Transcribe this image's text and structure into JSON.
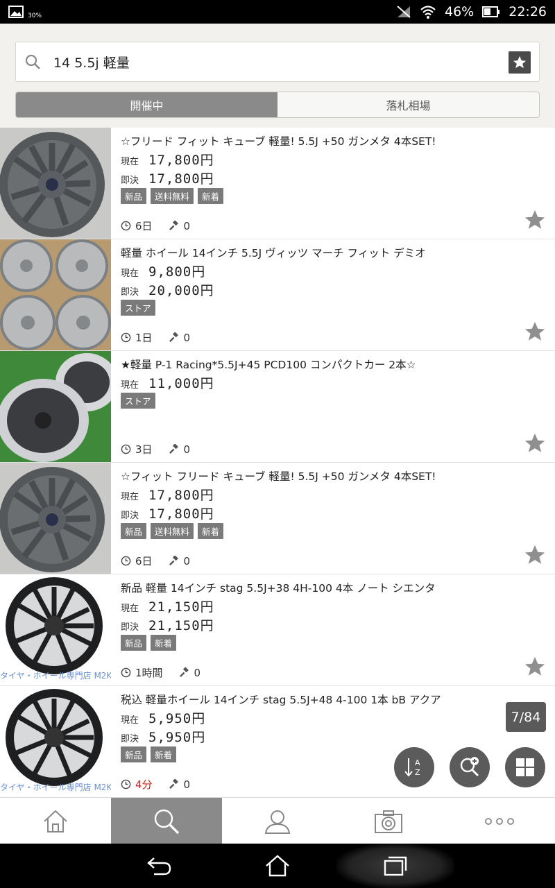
{
  "status_bar": {
    "battery_small": "30%",
    "battery_pct": "46%",
    "time": "22:26"
  },
  "search": {
    "query": "14 5.5j 軽量"
  },
  "tabs": [
    {
      "label": "開催中",
      "active": true
    },
    {
      "label": "落札相場",
      "active": false
    }
  ],
  "price_labels": {
    "current": "現在",
    "buyout": "即決"
  },
  "items": [
    {
      "title": "☆フリード フィット キューブ 軽量! 5.5J +50 ガンメタ 4本SET!",
      "current": "17,800円",
      "buyout": "17,800円",
      "badges": [
        "新品",
        "送料無料",
        "新着"
      ],
      "time_left": "6日",
      "bids": "0",
      "thumb": "gunmetal-wheel"
    },
    {
      "title": "軽量 ホイール 14インチ 5.5J ヴィッツ マーチ フィット デミオ",
      "current": "9,800円",
      "buyout": "20,000円",
      "badges": [
        "ストア"
      ],
      "time_left": "1日",
      "bids": "0",
      "thumb": "silver-wheels-4"
    },
    {
      "title": "★軽量 P-1 Racing*5.5J+45 PCD100 コンパクトカー 2本☆",
      "current": "11,000円",
      "buyout": null,
      "badges": [
        "ストア"
      ],
      "time_left": "3日",
      "bids": "0",
      "thumb": "wheels-on-grass"
    },
    {
      "title": "☆フィット フリード キューブ 軽量! 5.5J +50 ガンメタ 4本SET!",
      "current": "17,800円",
      "buyout": "17,800円",
      "badges": [
        "新品",
        "送料無料",
        "新着"
      ],
      "time_left": "6日",
      "bids": "0",
      "thumb": "gunmetal-wheel"
    },
    {
      "title": "新品 軽量 14インチ stag 5.5J+38 4H-100 4本 ノート シエンタ",
      "current": "21,150円",
      "buyout": "21,150円",
      "badges": [
        "新品",
        "新着"
      ],
      "time_left": "1時間",
      "bids": "0",
      "thumb": "black-polished-wheel",
      "watermark": "タイヤ・ホイール専門店 M2K"
    },
    {
      "title": "税込 軽量ホイール 14インチ stag 5.5J+48 4-100 1本 bB アクア",
      "current": "5,950円",
      "buyout": "5,950円",
      "badges": [
        "新品",
        "新着"
      ],
      "time_left": "4分",
      "time_urgent": true,
      "bids": "0",
      "thumb": "black-polished-wheel",
      "watermark": "タイヤ・ホイール専門店 M2K"
    }
  ],
  "page_indicator": "7/84",
  "fabs": [
    {
      "name": "sort-az-icon"
    },
    {
      "name": "search-plus-icon"
    },
    {
      "name": "grid-icon"
    }
  ],
  "bottom_nav": [
    {
      "name": "home-icon",
      "active": false
    },
    {
      "name": "search-icon",
      "active": true
    },
    {
      "name": "user-icon",
      "active": false
    },
    {
      "name": "camera-icon",
      "active": false
    },
    {
      "name": "more-icon",
      "active": false
    }
  ],
  "colors": {
    "accent_gray": "#8a8a8a",
    "badge_gray": "#7a7a7a",
    "urgent_red": "#c8231b",
    "search_bg": "#f2f1ed"
  }
}
